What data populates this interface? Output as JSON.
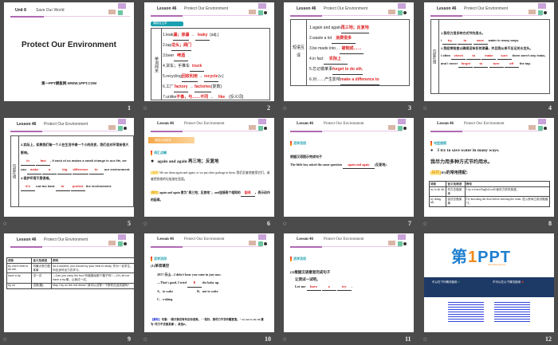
{
  "slides": [
    {
      "n": "1",
      "unit": "Unit 8",
      "unit_title": "Save Our World",
      "title": "Protect Our Environment",
      "site": "第一PPT模板网-WWW.1PPT.COM"
    },
    {
      "n": "2",
      "lesson": "Lesson 46",
      "lesson_title": "Protect Our Environment",
      "banner": "课前自主学",
      "side": "单词闯关",
      "items": [
        [
          "1.leak",
          "漏；渗漏",
          "leaky",
          "(adj.)"
        ],
        [
          "2.tap",
          "龙头；阀门",
          "",
          ""
        ],
        [
          "3.beer",
          "啤酒",
          "",
          ""
        ],
        [
          "4.货车；手推车",
          "truck",
          "",
          ""
        ],
        [
          "5.recycling",
          "回收利用",
          "recycle",
          "(v.)"
        ],
        [
          "6.工厂",
          "factory",
          "factories",
          "(复数)"
        ],
        [
          "7.unlike",
          "不像，与……不同",
          "like",
          "(反义词)"
        ]
      ]
    },
    {
      "n": "3",
      "lesson": "Lesson 46",
      "lesson_title": "Protect Our Environment",
      "side": "短语互译",
      "items": [
        [
          "1.again and again",
          "再三地；反复地"
        ],
        [
          "2.waste a lot",
          "浪费很多"
        ],
        [
          "3.be made into…",
          "被制成……"
        ],
        [
          "4.in fact",
          "实际上"
        ],
        [
          "5.忘记做某事",
          "forget to do sth."
        ],
        [
          "6.对……产生影响",
          "make a difference to"
        ]
      ]
    },
    {
      "n": "4",
      "lesson": "Lesson 46",
      "lesson_title": "Protect Our Environment",
      "side": "句型在线",
      "q1": "1.我尽力用多种方式节约用水。",
      "a1": [
        "I",
        "try",
        "to",
        "save",
        "water in many ways."
      ],
      "q2": "2.我经常检查以确保没有任何渗漏，并且我从来不忘记关水龙头。",
      "a2": [
        "I often",
        "check",
        "to",
        "make",
        "sure",
        "there aren't any leaks, and I never",
        "forget",
        "to",
        "turn",
        "off",
        "the tap."
      ]
    },
    {
      "n": "5",
      "lesson": "Lesson 46",
      "lesson_title": "Protect Our Environment",
      "side": "句型在线",
      "q3": "3.实际上，如果我们每一个人在生活中做一个小的改变，我们会对环境有很大影响。",
      "a3": [
        "In",
        "fact",
        ", if each of us makes a small change in our life, we can",
        "make",
        "a",
        "big",
        "difference",
        "to",
        "our environment."
      ],
      "q4": "4.保护环境不是很难。",
      "a4": [
        "It's",
        "not too hard",
        "to",
        "protect",
        "the environment."
      ]
    },
    {
      "n": "6",
      "lesson": "Lesson 46",
      "lesson_title": "Protect Our Environment",
      "banner": "课堂互动探究",
      "tag": "词汇点睛",
      "head": "again and again 再三地；反复地",
      "ex_label": "[观察]",
      "ex": "We use them again and again, or we put other garbage in them. 我们反复地使用它们，或者把其他的垃圾放在里面。",
      "ex2_label": "[探究]",
      "ex2a": "again and again 意为\"再三地；反复地\"，and连接两个相同的",
      "ex2b": "副词",
      "ex2c": "，表示动作的延续。"
    },
    {
      "n": "7",
      "lesson": "Lesson 46",
      "lesson_title": "Protect Our Environment",
      "tag": "活学活用",
      "q": "根据汉语提示完成句子",
      "s1": "The little boy asked the same question",
      "ans": "again and again",
      "s2": "(反复地)."
    },
    {
      "n": "8",
      "lesson": "Lesson 46",
      "lesson_title": "Protect Our Environment",
      "tag": "句型透视",
      "head": "I try to save water in many ways.",
      "cn": "我尽力用多种方式节约用水。",
      "ex_label": "[探究]",
      "ex": "try的常用搭配：",
      "table": [
        [
          "词条",
          "含义及用法",
          "例句"
        ],
        [
          "try to do sth.",
          "尽力去做某事",
          "I try to learn English well.我尽力学好英语。"
        ],
        [
          "try doing sth.",
          "尝试去做某事",
          "Try knocking the door before entering the room. 进入房间之前试敲敲门。"
        ]
      ]
    },
    {
      "n": "9",
      "lesson": "Lesson 46",
      "lesson_title": "Protect Our Environment",
      "table": [
        [
          "词条",
          "含义及用法",
          "例句"
        ],
        [
          "try one's best to do sth.",
          "尽最大努力做某事",
          "As a student, you should try your best to study. 作为一名学生，你应该尽全力去学习。"
        ],
        [
          "have a try",
          "试一试",
          "—Can you carry the box?你能搬动那个箱子吗?  —Oh, let me have a try.噢，让我试一试。"
        ],
        [
          "try on",
          "试穿(戴)",
          "May I try on the red dress? 我可以试穿一下那件红连衣裙吗?"
        ]
      ]
    },
    {
      "n": "10",
      "lesson": "Lesson 46",
      "lesson_title": "Protect Our Environment",
      "tag": "活学活用",
      "sec": "(1)单项填空",
      "q1": "2017·乐山—I didn't hear you come in just now.",
      "q2a": "—That's good. I tried",
      "ans": "B",
      "q2b": "the baby up.",
      "opts": [
        "A．to wake",
        "B．not to wake",
        "C．waking"
      ],
      "note_label": "【解析】",
      "note": "句意：\"刚才我没有听见你进来。\" \"很好，我尽力不去吵醒宝宝。\" try not to do sth.意为\"尽力不去做某事\"，故选B。"
    },
    {
      "n": "11",
      "lesson": "Lesson 46",
      "lesson_title": "Protect Our Environment",
      "tag": "活学活用",
      "sec": "(2)根据汉语意思完成句子",
      "cn": "让我试一试吧。",
      "s": "Let me",
      "ans": [
        "have",
        "a",
        "try"
      ]
    },
    {
      "n": "12",
      "logo_a": "第",
      "logo_b": "1",
      "logo_c": "PPT",
      "url": "http://www.1ppt.com",
      "ok": "可以在下列情况使用",
      "no": "不可以在以下情况使用"
    }
  ]
}
